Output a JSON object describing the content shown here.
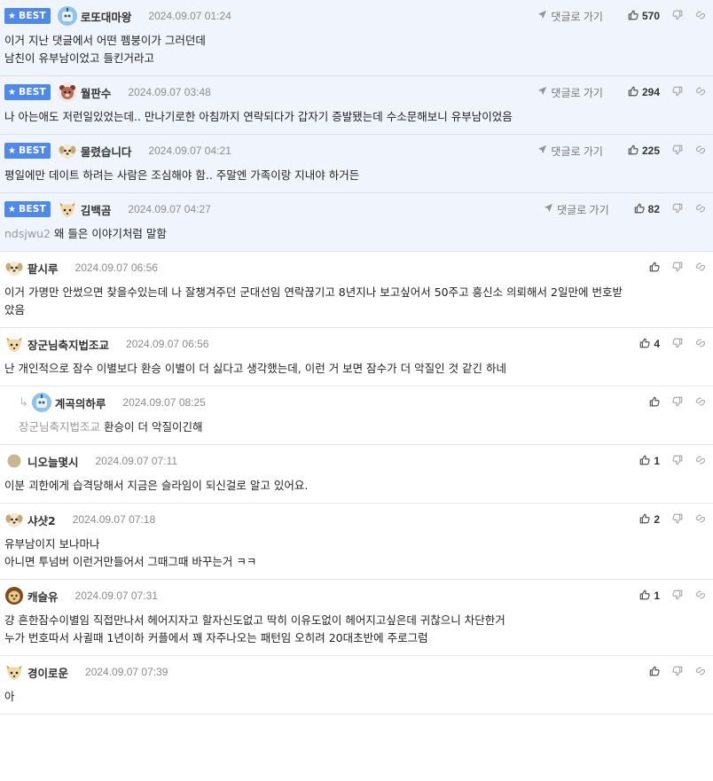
{
  "labels": {
    "best": "BEST",
    "go_reply": "댓글로 가기"
  },
  "colors": {
    "best_badge": "#4f8ae8",
    "best_bg": "#f0f4fc"
  },
  "comments": [
    {
      "id": "c1",
      "best": true,
      "avatar": "robot-avatar-icon",
      "nick": "로또대마왕",
      "date": "2024.09.07 01:24",
      "likes": "570",
      "lines": [
        "이거 지난 댓글에서 어떤 펨붕이가 그러던데",
        "남친이 유부남이었고 들킨거라고"
      ]
    },
    {
      "id": "c2",
      "best": true,
      "avatar": "bear-avatar-icon",
      "nick": "월판수",
      "date": "2024.09.07 03:48",
      "likes": "294",
      "lines": [
        "나 아는애도 저런일있었는데.. 만나기로한 아침까지 연락되다가 갑자기 증발됐는데 수소문해보니 유부남이었음"
      ]
    },
    {
      "id": "c3",
      "best": true,
      "avatar": "puppy-avatar-icon",
      "nick": "물렸습니다",
      "date": "2024.09.07 04:21",
      "likes": "225",
      "lines": [
        "평일에만 데이트 하려는 사람은 조심해야 함.. 주말엔 가족이랑 지내야 하거든"
      ]
    },
    {
      "id": "c4",
      "best": true,
      "avatar": "fox-avatar-icon",
      "nick": "김백곰",
      "date": "2024.09.07 04:27",
      "likes": "82",
      "mention": "ndsjwu2",
      "lines": [
        "왜 들은 이야기처럼 말함"
      ]
    },
    {
      "id": "c5",
      "best": false,
      "avatar": "puppy-avatar-icon",
      "nick": "팥시루",
      "date": "2024.09.07 06:56",
      "likes": "",
      "lines": [
        "이거 가명만 안썼으면 찾을수있는데 나 잘챙겨주던 군대선임 연락끊기고 8년지나 보고싶어서 50주고 흥신소 의뢰해서 2일만에 번호받",
        "았음"
      ]
    },
    {
      "id": "c6",
      "best": false,
      "avatar": "fox-avatar-icon",
      "nick": "장군님축지법조교",
      "date": "2024.09.07 06:56",
      "likes": "4",
      "lines": [
        "난 개인적으로 잠수 이별보다 환승 이별이 더 싫다고 생각했는데, 이런 거 보면 잠수가 더 악질인 것 같긴 하네"
      ]
    },
    {
      "id": "c7",
      "best": false,
      "reply": true,
      "avatar": "robot-avatar-icon",
      "nick": "계곡의하루",
      "date": "2024.09.07 08:25",
      "likes": "",
      "mention": "장군님축지법조교",
      "lines": [
        "환승이 더 악질이긴해"
      ]
    },
    {
      "id": "c8",
      "best": false,
      "avatar": "dot-avatar-icon",
      "nick": "니오늘몇시",
      "date": "2024.09.07 07:11",
      "likes": "1",
      "lines": [
        "이분 괴한에게 습격당해서 지금은 슬라임이 되신걸로 알고 있어요."
      ]
    },
    {
      "id": "c9",
      "best": false,
      "avatar": "puppy-avatar-icon",
      "nick": "샤샷2",
      "date": "2024.09.07 07:18",
      "likes": "2",
      "lines": [
        "유부남이지 보나마나",
        "아니면 투넘버 이런거만들어서 그때그때 바꾸는거 ㅋㅋ"
      ]
    },
    {
      "id": "c10",
      "best": false,
      "avatar": "lion-avatar-icon",
      "nick": "캐슬유",
      "date": "2024.09.07 07:31",
      "likes": "1",
      "lines": [
        "걍 흔한잠수이별임 직접만나서 헤어지자고 할자신도없고 딱히 이유도없이 헤어지고싶은데 귀찮으니 차단한거",
        "누가 번호따서 사귈때 1년이하 커플에서 꽤 자주나오는 패턴임 오히려 20대초반에 주로그럼"
      ]
    },
    {
      "id": "c11",
      "best": false,
      "avatar": "fox-avatar-icon",
      "nick": "경이로운",
      "date": "2024.09.07 07:39",
      "likes": "",
      "lines": [
        "아"
      ]
    }
  ]
}
